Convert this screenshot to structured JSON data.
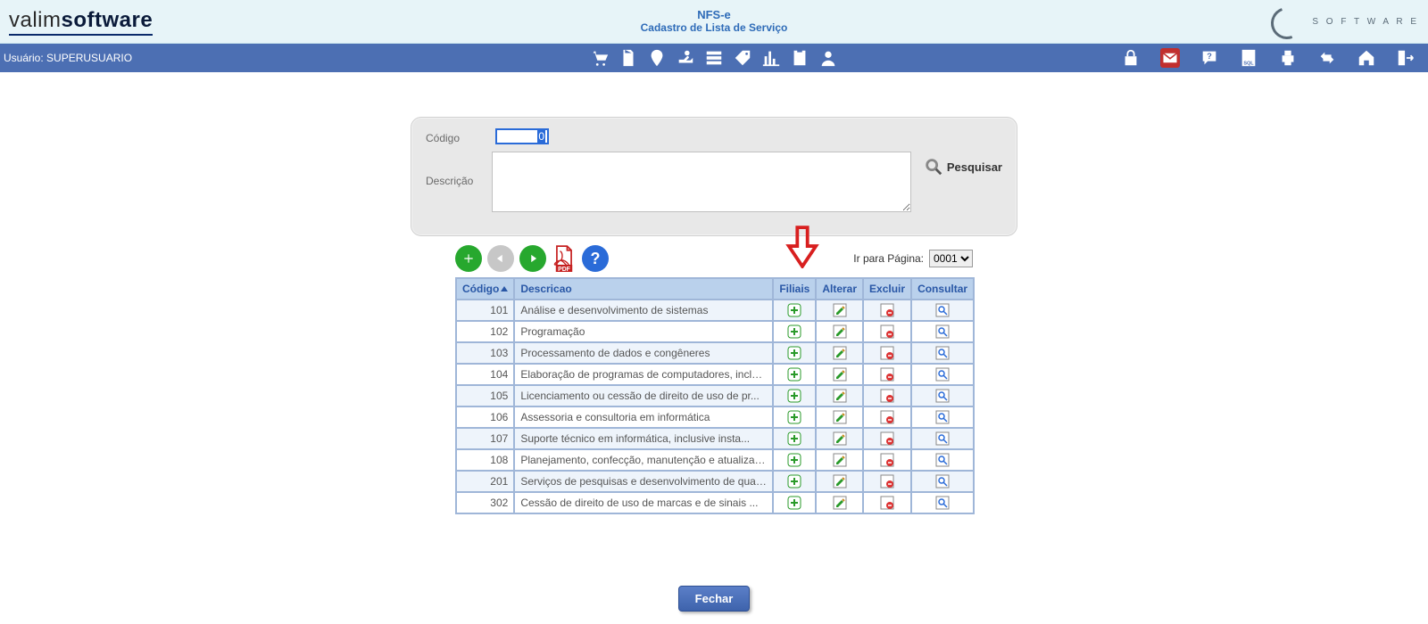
{
  "header": {
    "brand_left_a": "valim",
    "brand_left_b": "software",
    "title_1": "NFS-e",
    "title_2": "Cadastro de Lista de Serviço",
    "brand_right_sub": "S O F T W A R E"
  },
  "toolbar": {
    "user_label": "Usuário: SUPERUSUARIO"
  },
  "search": {
    "codigo_label": "Código",
    "codigo_value": "0",
    "descricao_label": "Descrição",
    "pesquisar_label": "Pesquisar"
  },
  "pager": {
    "label": "Ir para Página:",
    "selected": "0001",
    "options": [
      "0001"
    ]
  },
  "grid": {
    "headers": {
      "codigo": "Código",
      "descricao": "Descricao",
      "filiais": "Filiais",
      "alterar": "Alterar",
      "excluir": "Excluir",
      "consultar": "Consultar"
    },
    "rows": [
      {
        "codigo": "101",
        "descricao": "Análise e desenvolvimento de sistemas"
      },
      {
        "codigo": "102",
        "descricao": "Programação"
      },
      {
        "codigo": "103",
        "descricao": "Processamento de dados e congêneres"
      },
      {
        "codigo": "104",
        "descricao": "Elaboração de programas de computadores, inclus..."
      },
      {
        "codigo": "105",
        "descricao": "Licenciamento ou cessão de direito de uso de pr..."
      },
      {
        "codigo": "106",
        "descricao": "Assessoria e consultoria em informática"
      },
      {
        "codigo": "107",
        "descricao": "Suporte técnico em informática, inclusive insta..."
      },
      {
        "codigo": "108",
        "descricao": "Planejamento, confecção, manutenção e atualizaç..."
      },
      {
        "codigo": "201",
        "descricao": "Serviços de pesquisas e desenvolvimento de qual..."
      },
      {
        "codigo": "302",
        "descricao": "Cessão de direito de uso de marcas e de sinais ..."
      }
    ]
  },
  "footer": {
    "close_label": "Fechar"
  }
}
